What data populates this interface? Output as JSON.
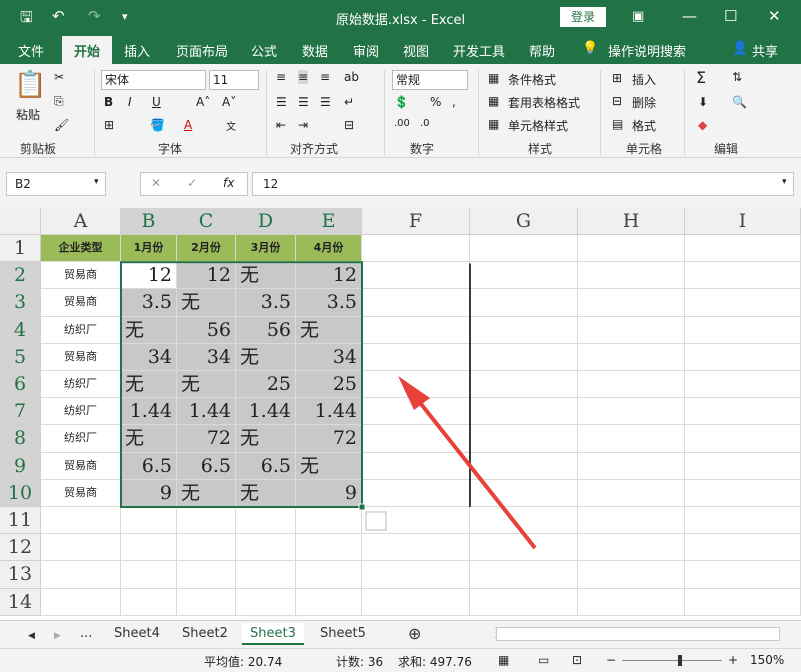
{
  "titlebar": {
    "title": "原始数据.xlsx  -  Excel",
    "login": "登录"
  },
  "tabs": [
    "文件",
    "开始",
    "插入",
    "页面布局",
    "公式",
    "数据",
    "审阅",
    "视图",
    "开发工具",
    "帮助"
  ],
  "tell_me": "操作说明搜索",
  "share": "共享",
  "ribbon": {
    "paste": "粘贴",
    "font_name": "宋体",
    "font_size": "11",
    "number_format": "常规",
    "cond_format": "条件格式",
    "table_format": "套用表格格式",
    "cell_style": "单元格样式",
    "insert": "插入",
    "delete": "删除",
    "format": "格式",
    "groups": {
      "clipboard": "剪贴板",
      "font": "字体",
      "alignment": "对齐方式",
      "number": "数字",
      "styles": "样式",
      "cells": "单元格",
      "editing": "编辑"
    }
  },
  "formula_bar": {
    "name_box": "B2",
    "value": "12"
  },
  "columns": [
    "A",
    "B",
    "C",
    "D",
    "E",
    "F",
    "G",
    "H",
    "I"
  ],
  "rows": [
    "1",
    "2",
    "3",
    "4",
    "5",
    "6",
    "7",
    "8",
    "9",
    "10",
    "11",
    "12",
    "13",
    "14"
  ],
  "table": {
    "header": [
      "企业类型",
      "1月份",
      "2月份",
      "3月份",
      "4月份"
    ],
    "rows": [
      [
        "贸易商",
        "12",
        "12",
        "无",
        "12"
      ],
      [
        "贸易商",
        "3.5",
        "无",
        "3.5",
        "3.5"
      ],
      [
        "纺织厂",
        "无",
        "56",
        "56",
        "无"
      ],
      [
        "贸易商",
        "34",
        "34",
        "无",
        "34"
      ],
      [
        "纺织厂",
        "无",
        "无",
        "25",
        "25"
      ],
      [
        "纺织厂",
        "1.44",
        "1.44",
        "1.44",
        "1.44"
      ],
      [
        "纺织厂",
        "无",
        "72",
        "无",
        "72"
      ],
      [
        "贸易商",
        "6.5",
        "6.5",
        "6.5",
        "无"
      ],
      [
        "贸易商",
        "9",
        "无",
        "无",
        "9"
      ]
    ]
  },
  "sheets": [
    "...",
    "Sheet4",
    "Sheet2",
    "Sheet3",
    "Sheet5"
  ],
  "active_sheet": "Sheet3",
  "status": {
    "average": "平均值: 20.74",
    "count": "计数: 36",
    "sum": "求和: 497.76",
    "zoom": "150%"
  },
  "colors": {
    "excel_green": "#217346",
    "header_fill": "#9bbb59",
    "selection_fill": "#c8c8c8"
  }
}
